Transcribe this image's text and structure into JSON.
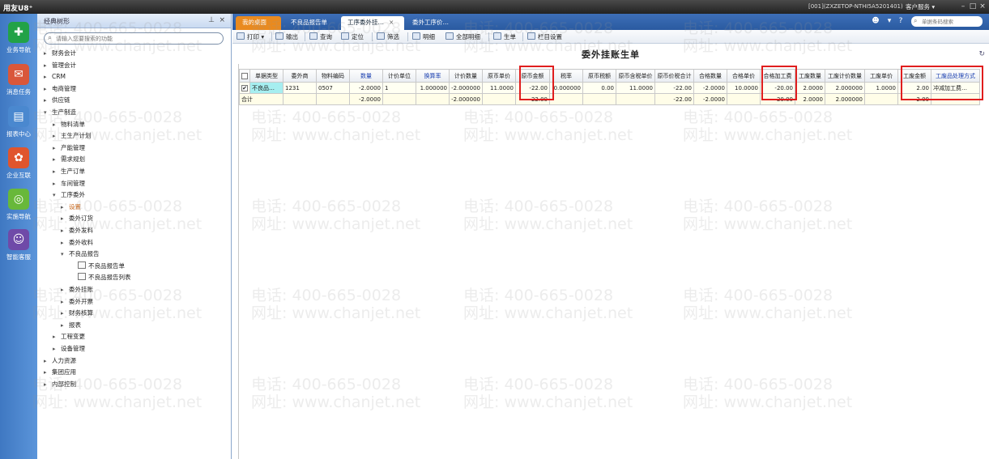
{
  "titlebar": {
    "logo": "用友U8⁺",
    "info": "[001](ZXZETOP-NTHI5A5201401)",
    "service": "客户服务 ▾"
  },
  "leftbar": [
    {
      "label": "业务导航",
      "color": "#22a247"
    },
    {
      "label": "消息任务",
      "color": "#d9573a"
    },
    {
      "label": "报表中心",
      "color": "#4a88cf"
    },
    {
      "label": "企业互联",
      "color": "#e0552d"
    },
    {
      "label": "实施导航",
      "color": "#68b83a"
    },
    {
      "label": "智能客服",
      "color": "#6f4aa8"
    }
  ],
  "nav": {
    "header": "经典树形",
    "search_placeholder": "请输入您要搜索的功能",
    "tree": [
      {
        "label": "财务会计",
        "arrow": "▸",
        "level": 0
      },
      {
        "label": "管理会计",
        "arrow": "▸",
        "level": 0
      },
      {
        "label": "CRM",
        "arrow": "▸",
        "level": 0
      },
      {
        "label": "电商管理",
        "arrow": "▸",
        "level": 0
      },
      {
        "label": "供应链",
        "arrow": "▸",
        "level": 0
      },
      {
        "label": "生产制造",
        "arrow": "▾",
        "level": 0
      },
      {
        "label": "物料清单",
        "arrow": "▸",
        "level": 1
      },
      {
        "label": "主生产计划",
        "arrow": "▸",
        "level": 1
      },
      {
        "label": "产能管理",
        "arrow": "▸",
        "level": 1
      },
      {
        "label": "需求规划",
        "arrow": "▸",
        "level": 1
      },
      {
        "label": "生产订单",
        "arrow": "▸",
        "level": 1
      },
      {
        "label": "车间管理",
        "arrow": "▸",
        "level": 1
      },
      {
        "label": "工序委外",
        "arrow": "▾",
        "level": 1
      },
      {
        "label": "设置",
        "arrow": "▸",
        "level": 2,
        "selected": true
      },
      {
        "label": "委外订货",
        "arrow": "▸",
        "level": 2
      },
      {
        "label": "委外发料",
        "arrow": "▸",
        "level": 2
      },
      {
        "label": "委外收料",
        "arrow": "▸",
        "level": 2
      },
      {
        "label": "不良品报告",
        "arrow": "▾",
        "level": 2
      },
      {
        "label": "不良品报告单",
        "arrow": "",
        "level": 3,
        "doc": true
      },
      {
        "label": "不良品报告列表",
        "arrow": "",
        "level": 3,
        "doc": true
      },
      {
        "label": "委外挂账",
        "arrow": "▸",
        "level": 2
      },
      {
        "label": "委外开票",
        "arrow": "▸",
        "level": 2
      },
      {
        "label": "财务核算",
        "arrow": "▸",
        "level": 2
      },
      {
        "label": "报表",
        "arrow": "▸",
        "level": 2
      },
      {
        "label": "工程变更",
        "arrow": "▸",
        "level": 1
      },
      {
        "label": "设备管理",
        "arrow": "▸",
        "level": 1
      },
      {
        "label": "人力资源",
        "arrow": "▸",
        "level": 0
      },
      {
        "label": "集团应用",
        "arrow": "▸",
        "level": 0
      },
      {
        "label": "内部控制",
        "arrow": "▸",
        "level": 0
      }
    ]
  },
  "tabs": [
    {
      "label": "我的桌面",
      "type": "first"
    },
    {
      "label": "不良品报告单",
      "type": "normal"
    },
    {
      "label": "工序委外挂…",
      "type": "active",
      "close": "×"
    },
    {
      "label": "委外工序价…",
      "type": "normal"
    }
  ],
  "search": {
    "placeholder": "单据条码搜索"
  },
  "toolbar": [
    {
      "label": "打印 ▾"
    },
    {
      "label": "输出"
    },
    {
      "label": "查询"
    },
    {
      "label": "定位"
    },
    {
      "label": "筛选"
    },
    {
      "label": "明细"
    },
    {
      "label": "全部明细"
    },
    {
      "label": "生单"
    },
    {
      "label": "栏目设置"
    }
  ],
  "document": {
    "title": "委外挂账生单",
    "columns": [
      "",
      "单据类型",
      "委外商",
      "物料编码",
      "数量",
      "计价单位",
      "换算率",
      "计价数量",
      "原币单价",
      "原币金额",
      "税率",
      "原币税额",
      "原币含税单价",
      "原币价税合计",
      "合格数量",
      "合格单价",
      "合格加工费",
      "工废数量",
      "工废计价数量",
      "工废单价",
      "工废金额",
      "工废品处理方式"
    ],
    "blue_columns": [
      4,
      6,
      21
    ],
    "row": [
      "✔",
      "不良品…",
      "1231",
      "0507",
      "-2.0000",
      "1",
      "1.000000",
      "-2.000000",
      "11.0000",
      "-22.00",
      "0.000000",
      "0.00",
      "11.0000",
      "-22.00",
      "-2.0000",
      "10.0000",
      "-20.00",
      "2.0000",
      "2.000000",
      "1.0000",
      "2.00",
      "冲减加工费…"
    ],
    "total": [
      "合计",
      "",
      "",
      "",
      "-2.0000",
      "",
      "",
      "-2.000000",
      "",
      "-22.00",
      "",
      "",
      "",
      "-22.00",
      "-2.0000",
      "",
      "-20.00",
      "2.0000",
      "2.000000",
      "",
      "2.00",
      ""
    ]
  },
  "watermark": {
    "phone": "电话: 400-665-0028",
    "site": "网址: www.chanjet.net"
  }
}
